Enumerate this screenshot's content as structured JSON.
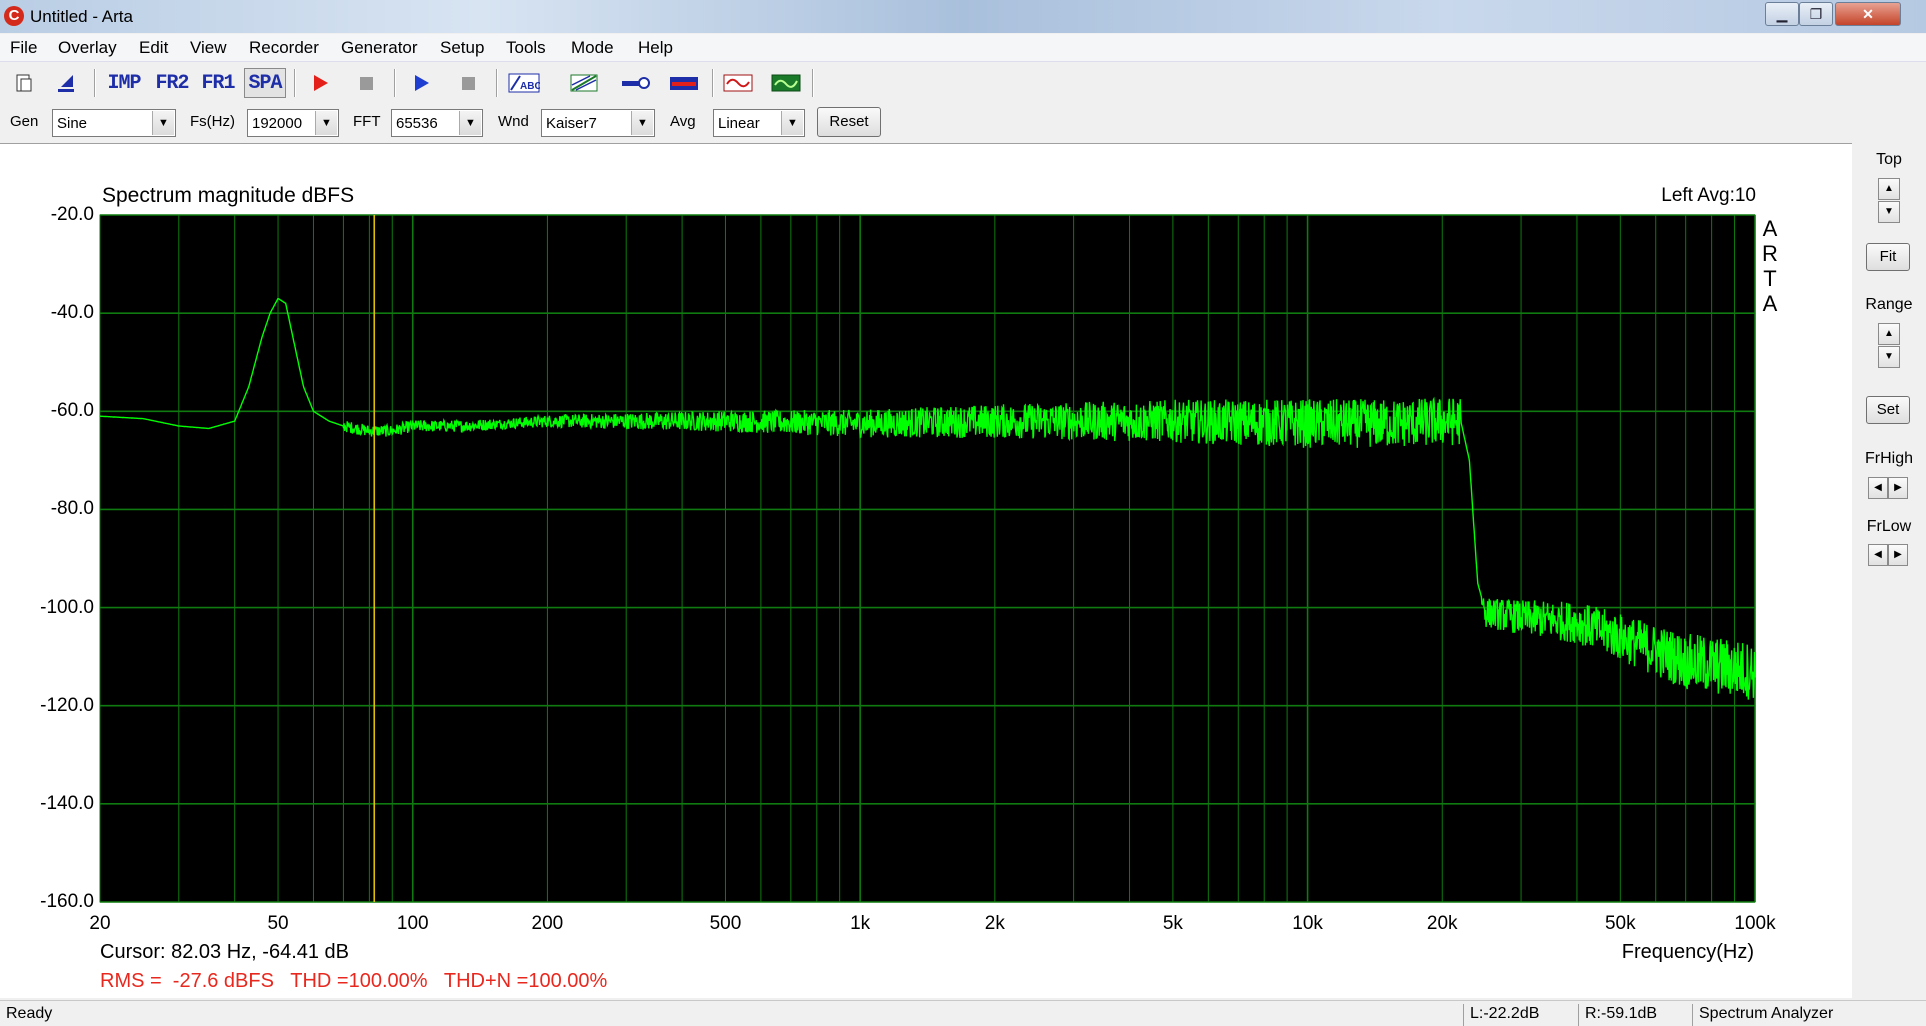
{
  "window": {
    "title": "Untitled - Arta",
    "app_icon": "C",
    "minimize": "▁",
    "maximize": "❐",
    "close": "✕"
  },
  "menu": [
    "File",
    "Overlay",
    "Edit",
    "View",
    "Recorder",
    "Generator",
    "Setup",
    "Tools",
    "Mode",
    "Help"
  ],
  "toolbar": {
    "imp": "IMP",
    "fr2": "FR2",
    "fr1": "FR1",
    "spa": "SPA",
    "icons": [
      "new-document-icon",
      "open-icon",
      "record-icon",
      "stop-icon",
      "play-icon",
      "stop-generator-icon",
      "abc-icon",
      "spectrum-filter-icon",
      "probe-icon",
      "calibrate-icon",
      "waveform-icon",
      "oscilloscope-icon"
    ]
  },
  "controls": {
    "gen_label": "Gen",
    "gen_value": "Sine",
    "fs_label": "Fs(Hz)",
    "fs_value": "192000",
    "fft_label": "FFT",
    "fft_value": "65536",
    "wnd_label": "Wnd",
    "wnd_value": "Kaiser7",
    "avg_label": "Avg",
    "avg_value": "Linear",
    "reset": "Reset"
  },
  "plot": {
    "title": "Spectrum magnitude dBFS",
    "channel_avg": "Left  Avg:10",
    "watermark": [
      "A",
      "R",
      "T",
      "A"
    ],
    "cursor_text": "Cursor: 82.03 Hz, -64.41 dB",
    "freq_label": "Frequency(Hz)",
    "rms_line": "RMS =  -27.6 dBFS   THD =100.00%   THD+N =100.00%",
    "y_ticks": [
      "-20.0",
      "-40.0",
      "-60.0",
      "-80.0",
      "-100.0",
      "-120.0",
      "-140.0",
      "-160.0"
    ],
    "x_ticks": [
      "20",
      "50",
      "100",
      "200",
      "500",
      "1k",
      "2k",
      "5k",
      "10k",
      "20k",
      "50k",
      "100k"
    ],
    "trace_color": "#00ff00",
    "grid_color": "#0f7a0f",
    "cursor_color": "#e0c000"
  },
  "side": {
    "top_label": "Top",
    "fit": "Fit",
    "range_label": "Range",
    "set": "Set",
    "frhigh_label": "FrHigh",
    "frlow_label": "FrLow",
    "up": "▲",
    "down": "▼",
    "left": "◀",
    "right": "▶"
  },
  "status": {
    "ready": "Ready",
    "left_level": "L:-22.2dB",
    "right_level": "R:-59.1dB",
    "mode": "Spectrum Analyzer"
  },
  "chart_data": {
    "type": "line",
    "title": "Spectrum magnitude dBFS",
    "xlabel": "Frequency(Hz)",
    "ylabel": "",
    "xscale": "log",
    "xlim": [
      20,
      100000
    ],
    "ylim": [
      -160,
      -20
    ],
    "grid": true,
    "cursor_x": 82.03,
    "series": [
      {
        "x": [
          20,
          25,
          30,
          35,
          40,
          43,
          46,
          48,
          50,
          52,
          54,
          57,
          60,
          65,
          70,
          80,
          90,
          100,
          130,
          200,
          300,
          500,
          1000,
          2000,
          5000,
          10000,
          15000,
          22000,
          23000,
          24000,
          25000,
          30000,
          40000,
          50000,
          70000,
          100000
        ],
        "y": [
          -61,
          -61.5,
          -63,
          -63.5,
          -62,
          -55,
          -45,
          -40,
          -37,
          -38,
          -45,
          -55,
          -60,
          -62,
          -63,
          -64,
          -64,
          -63,
          -63,
          -62,
          -62,
          -62,
          -62.5,
          -62,
          -62,
          -62.5,
          -62.5,
          -62,
          -70,
          -95,
          -101,
          -102,
          -103,
          -106,
          -111,
          -113
        ]
      }
    ]
  }
}
